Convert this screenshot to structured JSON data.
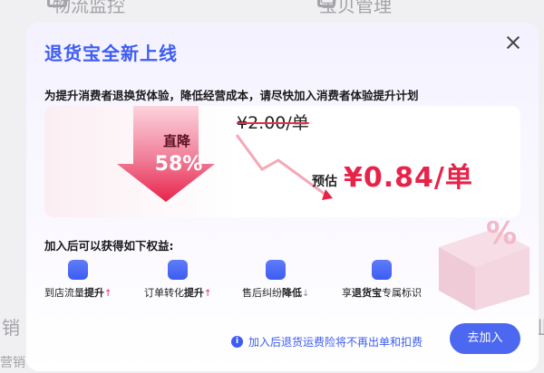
{
  "background": {
    "top_left_text": "物流监控",
    "top_right_text": "宝贝管理",
    "left_text_1": "销",
    "left_text_2": "营销",
    "right_text_1": "业"
  },
  "modal": {
    "title": "退货宝全新上线",
    "subtitle": "为提升消费者退换货体验，降低经营成本，请尽快加入消费者体验提升计划",
    "compare": {
      "drop_label": "直降",
      "drop_percent": "58%",
      "old_price": "¥2.00/单",
      "new_price_prefix": "预估",
      "new_price": "¥0.84/单"
    },
    "benefits_title": "加入后可以获得如下权益:",
    "benefits": [
      {
        "icon": "chart-up-icon",
        "text": "到店流量",
        "strong": "提升",
        "trend": "↑"
      },
      {
        "icon": "convert-icon",
        "text": "订单转化",
        "strong": "提升",
        "trend": "↑"
      },
      {
        "icon": "chart-down-icon",
        "text": "售后纠纷",
        "strong": "降低",
        "trend": "↓"
      },
      {
        "icon": "badge-icon",
        "text": "享",
        "strong": "退货宝",
        "trend": "专属标识"
      }
    ],
    "bottom_note": "加入后退货运费险将不再出单和扣费",
    "join_button": "去加入",
    "colors": {
      "accent": "#3d5cf2",
      "price_red": "#e8234a"
    }
  }
}
